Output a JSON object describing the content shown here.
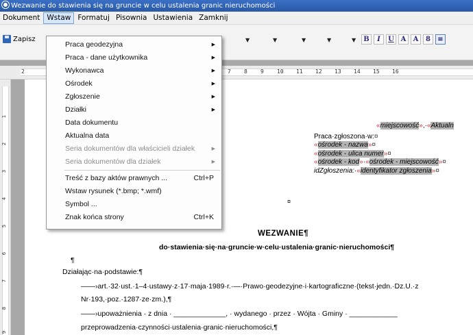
{
  "window": {
    "title": "Wezwanie do stawienia się na gruncie w celu ustalenia granic nieruchomości"
  },
  "menubar": {
    "items": [
      "Dokument",
      "Wstaw",
      "Formatuj",
      "Pisownia",
      "Ustawienia",
      "Zamknij"
    ],
    "active_index": 1
  },
  "toolbar": {
    "save_label": "Zapisz",
    "format_buttons": [
      "B",
      "I",
      "U",
      "A",
      "A",
      "8",
      "≡"
    ]
  },
  "ruler": {
    "numbers": [
      "2",
      "7",
      "8",
      "9",
      "10",
      "11",
      "12",
      "13",
      "14",
      "15",
      "16"
    ]
  },
  "vruler": {
    "numbers": [
      "1",
      "2",
      "3",
      "4",
      "5",
      "6",
      "7",
      "8",
      "9"
    ]
  },
  "menu": {
    "items": [
      {
        "label": "Praca geodezyjna",
        "submenu": true,
        "enabled": true
      },
      {
        "label": "Praca - dane użytkownika",
        "submenu": true,
        "enabled": true
      },
      {
        "label": "Wykonawca",
        "submenu": true,
        "enabled": true
      },
      {
        "label": "Ośrodek",
        "submenu": true,
        "enabled": true
      },
      {
        "label": "Zgłoszenie",
        "submenu": true,
        "enabled": true
      },
      {
        "label": "Działki",
        "submenu": true,
        "enabled": true
      },
      {
        "label": "Data dokumentu",
        "submenu": false,
        "enabled": true
      },
      {
        "label": "Aktualna data",
        "submenu": false,
        "enabled": true
      },
      {
        "label": "Seria dokumentów dla właścicieli działek",
        "submenu": true,
        "enabled": false
      },
      {
        "label": "Seria dokumentów dla działek",
        "submenu": true,
        "enabled": false
      },
      {
        "separator": true
      },
      {
        "label": "Treść z bazy aktów prawnych ...",
        "shortcut": "Ctrl+P",
        "enabled": true
      },
      {
        "label": "Wstaw rysunek (*.bmp; *.wmf)",
        "enabled": true
      },
      {
        "label": "Symbol ...",
        "enabled": true
      },
      {
        "label": "Znak końca strony",
        "shortcut": "Ctrl+K",
        "enabled": true
      }
    ]
  },
  "document": {
    "fields": {
      "miejscowosc": "miejscowość",
      "aktualna": "Aktualn",
      "praca_label": "Praca·zgłoszona·w:",
      "osrodek_nazwa": "ośrodek - nazwa",
      "osrodek_ulica": "ośrodek - ulica numer",
      "osrodek_kod": "ośrodek - kod",
      "osrodek_miejscowosc": "ośrodek - miejscowość",
      "id_label": "idZgłoszenia:·",
      "identyfikator": "identyfikator zgłoszenia"
    },
    "heading": "WEZWANIE¶",
    "subheading": "do·stawienia·się·na·gruncie·w·celu·ustalenia·granic·nieruchomości¶",
    "lines": [
      "¶",
      "Działając·na·podstawie:¶",
      "——›art.·32·ust.·1–4·ustawy·z·17·maja·1989·r.·—·Prawo·geodezyjne·i·kartograficzne·(tekst·jedn.·Dz.U.·z",
      "Nr·193,·poz.·1287·ze·zm.),¶",
      "——›upoważnienia · z dnia · _____________, · wydanego · przez · Wójta · Gminy · ____________",
      "przeprowadzenia·czynności·ustalenia·granic·nieruchomości,¶"
    ]
  }
}
